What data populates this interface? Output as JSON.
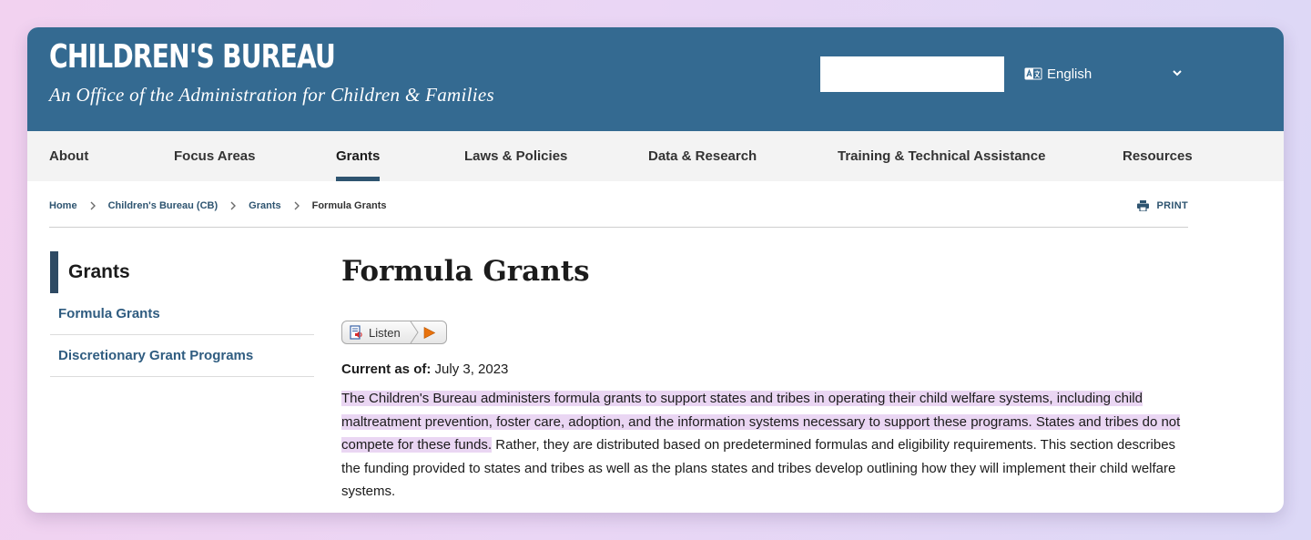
{
  "header": {
    "title": "CHILDREN'S BUREAU",
    "tagline": "An Office of the Administration for Children & Families",
    "search": {
      "value": "",
      "placeholder": ""
    },
    "language": "English"
  },
  "nav": {
    "items": [
      "About",
      "Focus Areas",
      "Grants",
      "Laws & Policies",
      "Data & Research",
      "Training & Technical Assistance",
      "Resources"
    ],
    "active": "Grants"
  },
  "breadcrumb": {
    "items": [
      "Home",
      "Children's Bureau (CB)",
      "Grants"
    ],
    "current": "Formula Grants"
  },
  "print_label": "PRINT",
  "sidebar": {
    "heading": "Grants",
    "links": [
      "Formula Grants",
      "Discretionary Grant Programs"
    ]
  },
  "main": {
    "title": "Formula Grants",
    "listen_label": "Listen",
    "current_as_of_label": "Current as of:",
    "current_as_of_date": "July 3, 2023",
    "paragraph_highlighted": "The Children's Bureau administers formula grants to support states and tribes in operating their child welfare systems, including child maltreatment prevention, foster care, adoption, and the information systems necessary to support these programs. States and tribes do not compete for these funds.",
    "paragraph_rest": " Rather, they are distributed based on predetermined formulas and eligibility requirements. This section describes the funding provided to states and tribes as well as the plans states and tribes develop outlining how they will implement their child welfare systems."
  },
  "colors": {
    "header_bg": "#346a91",
    "nav_bg": "#f3f3f3",
    "active_underline": "#2e5470",
    "link": "#2f5c80",
    "highlight": "#ead6f3"
  }
}
